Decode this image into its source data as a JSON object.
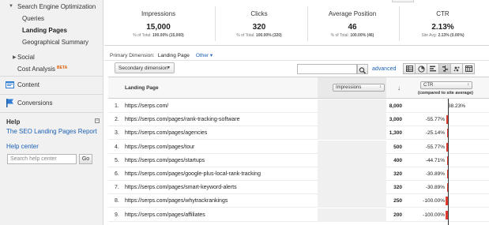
{
  "sidebar": {
    "seo_label": "Search Engine Optimization",
    "queries": "Queries",
    "landing_pages": "Landing Pages",
    "geo_summary": "Geographical Summary",
    "social": "Social",
    "cost_analysis": "Cost Analysis",
    "beta": "BETA",
    "content": "Content",
    "conversions": "Conversions",
    "help_title": "Help",
    "help_minimize": "−",
    "help_article": "The SEO Landing Pages Report",
    "help_center": "Help center",
    "help_search_placeholder": "Search help center",
    "go": "Go"
  },
  "summary": [
    {
      "name": "Impressions",
      "value": "15,000",
      "sub_prefix": "% of Total: ",
      "sub_bold": "100.00% (15,000)"
    },
    {
      "name": "Clicks",
      "value": "320",
      "sub_prefix": "% of Total: ",
      "sub_bold": "100.00% (320)"
    },
    {
      "name": "Average Position",
      "value": "46",
      "sub_prefix": "% of Total: ",
      "sub_bold": "100.00% (46)"
    },
    {
      "name": "CTR",
      "value": "2.13%",
      "sub_prefix": "Site Avg: ",
      "sub_bold": "2.13% (0.00%)"
    }
  ],
  "primary_dimension": {
    "label": "Primary Dimension:",
    "current": "Landing Page",
    "other": "Other ▾"
  },
  "toolbar": {
    "secondary_dimension": "Secondary dimension",
    "advanced": "advanced",
    "view_icons": [
      "table-view-icon",
      "pie-view-icon",
      "performance-view-icon",
      "comparison-view-icon",
      "term-cloud-view-icon",
      "pivot-view-icon"
    ]
  },
  "table": {
    "col_landing_page": "Landing Page",
    "impressions_select": "Impressions",
    "ctr_select": "CTR",
    "ctr_sub": "(compared to site average)",
    "sort_arrow": "↓",
    "rows": [
      {
        "num": "1.",
        "page": "https://serps.com/",
        "impressions": "8,000",
        "ctr": "38.23%",
        "ctr_val": 38.23
      },
      {
        "num": "2.",
        "page": "https://serps.com/pages/rank-tracking-software",
        "impressions": "3,000",
        "ctr": "-55.77%",
        "ctr_val": -55.77
      },
      {
        "num": "3.",
        "page": "https://serps.com/pages/agencies",
        "impressions": "1,300",
        "ctr": "-25.14%",
        "ctr_val": -25.14
      },
      {
        "num": "4.",
        "page": "https://serps.com/pages/tour",
        "impressions": "500",
        "ctr": "-55.77%",
        "ctr_val": -55.77
      },
      {
        "num": "5.",
        "page": "https://serps.com/pages/startups",
        "impressions": "400",
        "ctr": "-44.71%",
        "ctr_val": -44.71
      },
      {
        "num": "6.",
        "page": "https://serps.com/pages/google-plus-local-rank-tracking",
        "impressions": "320",
        "ctr": "-30.89%",
        "ctr_val": -30.89
      },
      {
        "num": "7.",
        "page": "https://serps.com/pages/smart-keyword-alerts",
        "impressions": "320",
        "ctr": "-30.89%",
        "ctr_val": -30.89
      },
      {
        "num": "8.",
        "page": "https://serps.com/pages/whytrackrankings",
        "impressions": "250",
        "ctr": "-100.00%",
        "ctr_val": -100
      },
      {
        "num": "9.",
        "page": "https://serps.com/pages/affiliates",
        "impressions": "200",
        "ctr": "-100.00%",
        "ctr_val": -100
      }
    ]
  },
  "colors": {
    "negative_bar": "#e03c31",
    "positive_bar": "#3b8b3b",
    "link": "#1a5fb4",
    "beta": "#e05a00"
  }
}
